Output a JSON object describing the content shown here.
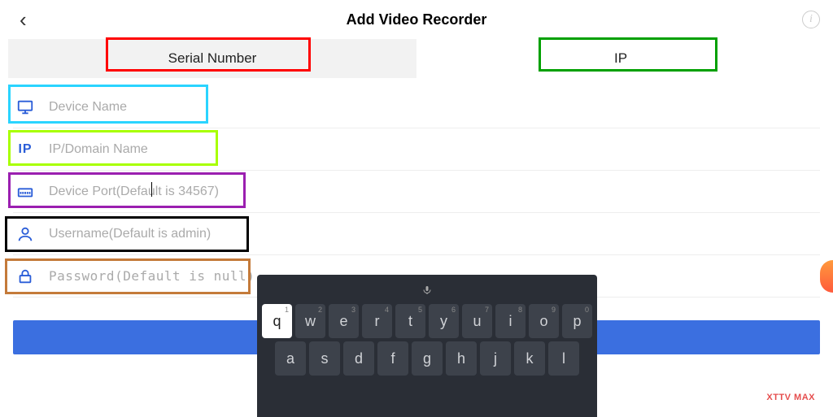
{
  "header": {
    "title": "Add Video Recorder"
  },
  "tabs": {
    "serial": "Serial Number",
    "ip": "IP"
  },
  "fields": {
    "device_name": {
      "placeholder": "Device Name",
      "value": ""
    },
    "ip_domain": {
      "placeholder": "IP/Domain Name",
      "value": ""
    },
    "port": {
      "placeholder": "Device Port(Default is 34567)",
      "value": ""
    },
    "username": {
      "placeholder": "Username(Default is admin)",
      "value": ""
    },
    "password": {
      "placeholder": "Password(Default is null)",
      "value": ""
    }
  },
  "highlights": {
    "serial_tab": "#ff0000",
    "ip_tab": "#00a000",
    "device_name": "#2ad4ff",
    "ip_domain": "#a8ff00",
    "port": "#9b1fb0",
    "username": "#000000",
    "password": "#c47a3a"
  },
  "keyboard": {
    "row1": [
      "q",
      "w",
      "e",
      "r",
      "t",
      "y",
      "u",
      "i",
      "o",
      "p"
    ],
    "row1_sup": [
      "1",
      "2",
      "3",
      "4",
      "5",
      "6",
      "7",
      "8",
      "9",
      "0"
    ],
    "row2": [
      "a",
      "s",
      "d",
      "f",
      "g",
      "h",
      "j",
      "k",
      "l"
    ],
    "active_key": "q"
  },
  "watermark": "XTTV MAX"
}
